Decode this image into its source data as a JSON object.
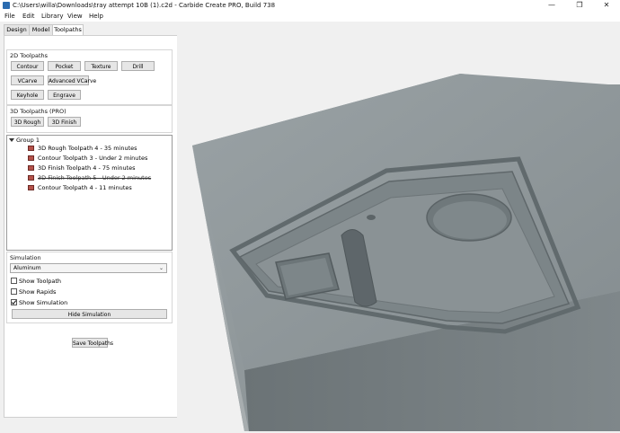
{
  "window": {
    "title": "C:\\Users\\willa\\Downloads\\tray attempt 10B (1).c2d - Carbide Create PRO, Build 738",
    "minimize_glyph": "—",
    "maximize_glyph": "❐",
    "close_glyph": "✕"
  },
  "menu": [
    "File",
    "Edit",
    "Library",
    "View",
    "Help"
  ],
  "tabs": [
    {
      "label": "Design",
      "active": false
    },
    {
      "label": "Model",
      "active": false
    },
    {
      "label": "Toolpaths",
      "active": true
    }
  ],
  "toolpaths_2d": {
    "title": "2D Toolpaths",
    "buttons": [
      "Contour",
      "Pocket",
      "Texture",
      "Drill",
      "VCarve",
      "Advanced VCarve",
      "Keyhole",
      "Engrave"
    ]
  },
  "toolpaths_3d": {
    "title": "3D Toolpaths (PRO)",
    "buttons": [
      "3D Rough",
      "3D Finish"
    ]
  },
  "tree": {
    "group": "Group 1",
    "items": [
      {
        "label": "3D Rough Toolpath 4 - 35 minutes",
        "disabled": false
      },
      {
        "label": "Contour Toolpath 3 - Under 2 minutes",
        "disabled": false
      },
      {
        "label": "3D Finish Toolpath 4 - 75 minutes",
        "disabled": false
      },
      {
        "label": "3D Finish Toolpath 5 - Under 2 minutes",
        "disabled": true
      },
      {
        "label": "Contour Toolpath 4 - 11 minutes",
        "disabled": false
      }
    ]
  },
  "simulation": {
    "title": "Simulation",
    "material": "Aluminum",
    "show_toolpath": {
      "label": "Show Toolpath",
      "checked": false
    },
    "show_rapids": {
      "label": "Show Rapids",
      "checked": false
    },
    "show_simulation": {
      "label": "Show Simulation",
      "checked": true
    },
    "hide_button": "Hide Simulation"
  },
  "save_button": "Save Toolpaths",
  "colors": {
    "stock_top": "#8e9699",
    "stock_side_left": "#a5abad",
    "stock_side_front": "#727a7d",
    "pocket_floor": "#7a8387"
  }
}
